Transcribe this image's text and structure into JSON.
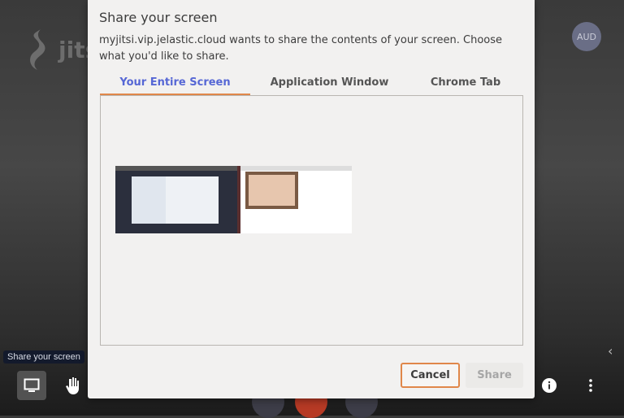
{
  "background": {
    "logo_text": "jitsi",
    "avatar_initials": "AUD",
    "tooltip": "Share your screen"
  },
  "toolbar": {
    "icons": [
      "desktop-icon",
      "raise-hand-icon",
      "info-icon",
      "more-vertical-icon",
      "chevron-left-icon"
    ]
  },
  "dialog": {
    "title": "Share your screen",
    "message": "myjitsi.vip.jelastic.cloud wants to share the contents of your screen. Choose what you'd like to share.",
    "tabs": [
      {
        "label": "Your Entire Screen",
        "active": true
      },
      {
        "label": "Application Window",
        "active": false
      },
      {
        "label": "Chrome Tab",
        "active": false
      }
    ],
    "cancel_label": "Cancel",
    "share_label": "Share",
    "share_enabled": false
  },
  "colors": {
    "accent_tab": "#5667d5",
    "focus": "#e0874a",
    "hangup": "#c0392b"
  }
}
